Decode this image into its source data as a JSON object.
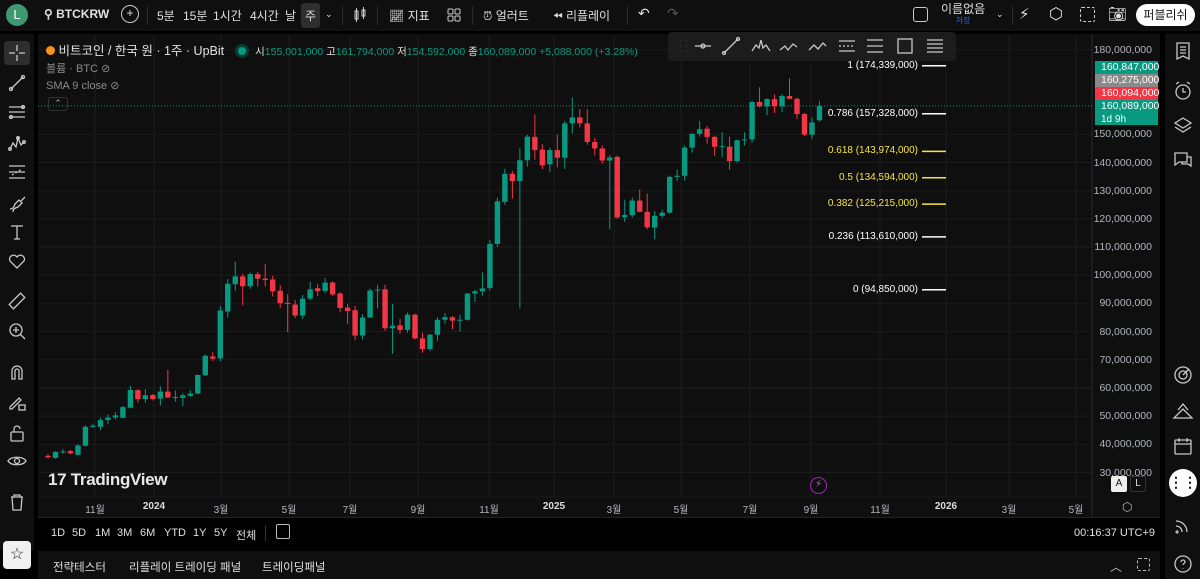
{
  "topbar": {
    "avatar": "L",
    "symbol": "BTCKRW",
    "intervals": [
      "5분",
      "15분",
      "1시간",
      "4시간",
      "날",
      "주"
    ],
    "active_interval": "주",
    "indicators_label": "지표",
    "alert_label": "얼러트",
    "replay_label": "리플레이",
    "layout_name": "이름없음",
    "save_label": "저장",
    "publish_label": "퍼블리쉬"
  },
  "legend": {
    "title": "비트코인 / 한국 원 · 1주 · UpBit",
    "open_label": "시",
    "open": "155,001,000",
    "high_label": "고",
    "high": "161,794,000",
    "low_label": "저",
    "low": "154,592,000",
    "close_label": "종",
    "close": "160,089,000",
    "change": "+5,088,000 (+3.28%)",
    "volume": "볼륨 · BTC",
    "sma": "SMA 9 close"
  },
  "price_badges": [
    {
      "text": "160,847,000",
      "color": "#089981"
    },
    {
      "text": "160,275,000",
      "color": "#8a8a8a"
    },
    {
      "text": "160,094,000",
      "color": "#f23645"
    },
    {
      "text": "160,089,000",
      "color": "#089981"
    }
  ],
  "countdown": "1d 9h",
  "watermark": "TradingView",
  "time_axis": [
    "11월",
    "2024",
    "3월",
    "5월",
    "7월",
    "9월",
    "11월",
    "2025",
    "3월",
    "5월",
    "7월",
    "9월",
    "11월",
    "2026",
    "3월",
    "5월"
  ],
  "range_buttons": [
    "1D",
    "5D",
    "1M",
    "3M",
    "6M",
    "YTD",
    "1Y",
    "5Y",
    "전체"
  ],
  "clock": "00:16:37 UTC+9",
  "scale_buttons": [
    "A",
    "L"
  ],
  "bottom_tabs": [
    "전략테스터",
    "리플레이 트레이딩 패널",
    "트레이딩패널"
  ],
  "colors": {
    "up": "#089981",
    "down": "#f23645",
    "fib_white": "#ffffff",
    "fib_yellow": "#f5e642",
    "background": "#0f0f0f"
  },
  "chart_data": {
    "type": "candlestick",
    "symbol": "BTCKRW",
    "interval": "1W",
    "exchange": "UpBit",
    "ylim": [
      30000000,
      180000000
    ],
    "y_ticks": [
      "180,000,000",
      "150,000,000",
      "140,000,000",
      "130,000,000",
      "120,000,000",
      "110,000,000",
      "100,000,000",
      "90,000,000",
      "80,000,000",
      "70,000,000",
      "60,000,000",
      "50,000,000",
      "40,000,000",
      "30,000,000"
    ],
    "y_tick_values": [
      180000000,
      150000000,
      140000000,
      130000000,
      120000000,
      110000000,
      100000000,
      90000000,
      80000000,
      70000000,
      60000000,
      50000000,
      40000000,
      30000000
    ],
    "last_price": 160089000,
    "fibonacci": [
      {
        "label": "1 (174,339,000)",
        "price": 174339000,
        "color": "#ffffff"
      },
      {
        "label": "0.786 (157,328,000)",
        "price": 157328000,
        "color": "#ffffff"
      },
      {
        "label": "0.618 (143,974,000)",
        "price": 143974000,
        "color": "#f5e642"
      },
      {
        "label": "0.5 (134,594,000)",
        "price": 134594000,
        "color": "#f5e642"
      },
      {
        "label": "0.382 (125,215,000)",
        "price": 125215000,
        "color": "#f5e642"
      },
      {
        "label": "0.236 (113,610,000)",
        "price": 113610000,
        "color": "#ffffff"
      },
      {
        "label": "0 (94,850,000)",
        "price": 94850000,
        "color": "#ffffff"
      }
    ],
    "ohlc": [
      [
        35900000,
        36500000,
        35000000,
        35400000
      ],
      [
        35200000,
        37600000,
        34900000,
        37300000
      ],
      [
        37300000,
        38400000,
        36600000,
        37500000
      ],
      [
        37600000,
        38000000,
        36500000,
        36800000
      ],
      [
        36300000,
        40000000,
        36000000,
        39600000
      ],
      [
        39500000,
        46800000,
        39200000,
        46200000
      ],
      [
        46200000,
        47300000,
        45800000,
        46600000
      ],
      [
        46200000,
        49500000,
        45000000,
        48600000
      ],
      [
        48600000,
        50600000,
        47100000,
        49500000
      ],
      [
        49500000,
        51500000,
        48800000,
        50300000
      ],
      [
        49400000,
        53600000,
        49200000,
        53200000
      ],
      [
        53000000,
        60700000,
        52800000,
        59300000
      ],
      [
        59200000,
        59600000,
        54800000,
        56000000
      ],
      [
        56000000,
        59600000,
        54700000,
        57400000
      ],
      [
        57500000,
        57900000,
        55500000,
        56100000
      ],
      [
        56200000,
        60600000,
        53700000,
        58700000
      ],
      [
        58700000,
        66400000,
        56500000,
        56600000
      ],
      [
        56600000,
        59100000,
        55100000,
        56800000
      ],
      [
        56500000,
        58000000,
        53600000,
        57400000
      ],
      [
        57200000,
        59200000,
        56800000,
        58000000
      ],
      [
        58000000,
        64800000,
        57800000,
        64600000
      ],
      [
        64500000,
        71900000,
        64200000,
        71400000
      ],
      [
        71200000,
        72700000,
        69600000,
        70400000
      ],
      [
        70500000,
        89000000,
        69500000,
        87500000
      ],
      [
        87100000,
        98700000,
        85000000,
        97000000
      ],
      [
        96800000,
        104800000,
        94500000,
        99600000
      ],
      [
        99600000,
        100600000,
        89300000,
        96100000
      ],
      [
        96100000,
        101000000,
        95200000,
        100400000
      ],
      [
        100400000,
        101200000,
        96000000,
        98800000
      ],
      [
        98800000,
        104000000,
        96000000,
        98300000
      ],
      [
        98500000,
        99800000,
        92500000,
        94300000
      ],
      [
        94500000,
        96500000,
        88400000,
        90100000
      ],
      [
        90200000,
        93300000,
        79800000,
        89800000
      ],
      [
        89600000,
        91200000,
        84800000,
        85700000
      ],
      [
        85700000,
        93000000,
        84500000,
        91700000
      ],
      [
        91700000,
        97700000,
        91200000,
        95000000
      ],
      [
        95400000,
        96800000,
        92600000,
        94400000
      ],
      [
        94400000,
        99000000,
        93600000,
        97400000
      ],
      [
        97400000,
        97900000,
        92700000,
        93200000
      ],
      [
        93500000,
        94000000,
        86900000,
        88400000
      ],
      [
        88500000,
        89800000,
        82800000,
        87300000
      ],
      [
        87600000,
        89100000,
        76900000,
        78600000
      ],
      [
        78600000,
        86200000,
        77200000,
        85000000
      ],
      [
        85000000,
        95300000,
        84800000,
        94600000
      ],
      [
        94600000,
        96600000,
        88200000,
        94900000
      ],
      [
        95000000,
        96600000,
        80300000,
        81200000
      ],
      [
        81200000,
        89800000,
        72100000,
        82100000
      ],
      [
        82200000,
        84500000,
        79200000,
        80600000
      ],
      [
        80600000,
        86800000,
        79600000,
        86000000
      ],
      [
        86000000,
        86400000,
        77200000,
        77600000
      ],
      [
        77600000,
        79600000,
        72500000,
        73800000
      ],
      [
        73800000,
        79200000,
        73200000,
        78900000
      ],
      [
        78900000,
        85100000,
        76700000,
        84200000
      ],
      [
        84200000,
        86600000,
        82800000,
        85100000
      ],
      [
        85100000,
        85500000,
        80800000,
        83900000
      ],
      [
        83900000,
        86000000,
        80000000,
        84200000
      ],
      [
        84200000,
        93700000,
        83900000,
        93500000
      ],
      [
        93500000,
        94800000,
        90500000,
        94300000
      ],
      [
        94300000,
        101000000,
        92800000,
        95300000
      ],
      [
        95500000,
        112500000,
        94600000,
        111100000
      ],
      [
        111100000,
        127500000,
        110000000,
        126200000
      ],
      [
        126000000,
        137800000,
        125000000,
        136000000
      ],
      [
        136000000,
        137000000,
        127200000,
        133400000
      ],
      [
        133400000,
        145000000,
        88200000,
        140800000
      ],
      [
        140800000,
        149800000,
        138500000,
        149200000
      ],
      [
        149100000,
        157100000,
        141000000,
        144400000
      ],
      [
        144600000,
        146500000,
        137700000,
        139000000
      ],
      [
        139400000,
        145300000,
        136600000,
        144400000
      ],
      [
        144400000,
        150000000,
        138300000,
        141700000
      ],
      [
        141700000,
        154800000,
        137700000,
        153900000
      ],
      [
        153900000,
        163100000,
        150400000,
        156000000
      ],
      [
        156000000,
        159000000,
        152500000,
        153900000
      ],
      [
        153900000,
        159000000,
        146300000,
        147300000
      ],
      [
        147300000,
        148800000,
        142500000,
        145000000
      ],
      [
        145000000,
        146000000,
        139600000,
        140700000
      ],
      [
        140700000,
        142700000,
        116300000,
        141800000
      ],
      [
        142000000,
        142500000,
        120000000,
        120500000
      ],
      [
        120600000,
        126800000,
        118900000,
        121400000
      ],
      [
        121300000,
        127600000,
        120500000,
        126500000
      ],
      [
        126500000,
        130400000,
        122300000,
        122500000
      ],
      [
        122500000,
        129000000,
        116300000,
        117000000
      ],
      [
        116900000,
        122800000,
        112700000,
        121100000
      ],
      [
        121100000,
        123200000,
        120500000,
        122200000
      ],
      [
        122200000,
        135400000,
        121900000,
        134900000
      ],
      [
        134900000,
        137500000,
        133500000,
        135300000
      ],
      [
        135300000,
        146000000,
        133600000,
        145300000
      ],
      [
        145300000,
        150300000,
        143500000,
        150200000
      ],
      [
        150200000,
        154700000,
        149200000,
        151800000
      ],
      [
        152000000,
        153000000,
        146700000,
        149100000
      ],
      [
        149100000,
        149500000,
        142400000,
        145600000
      ],
      [
        145600000,
        150800000,
        141900000,
        145800000
      ],
      [
        145600000,
        149200000,
        137400000,
        140500000
      ],
      [
        140500000,
        148200000,
        140000000,
        147900000
      ],
      [
        147900000,
        150700000,
        146000000,
        148200000
      ],
      [
        148200000,
        161800000,
        147000000,
        161500000
      ],
      [
        161500000,
        166700000,
        159500000,
        159900000
      ],
      [
        159900000,
        162800000,
        156800000,
        162500000
      ],
      [
        162500000,
        164200000,
        157600000,
        159900000
      ],
      [
        159900000,
        164300000,
        157800000,
        163600000
      ],
      [
        163600000,
        169900000,
        162400000,
        162600000
      ],
      [
        162600000,
        163000000,
        155500000,
        157200000
      ],
      [
        157200000,
        157600000,
        149400000,
        149900000
      ],
      [
        149900000,
        156000000,
        148400000,
        154200000
      ],
      [
        155001000,
        161794000,
        154592000,
        160089000
      ]
    ]
  }
}
